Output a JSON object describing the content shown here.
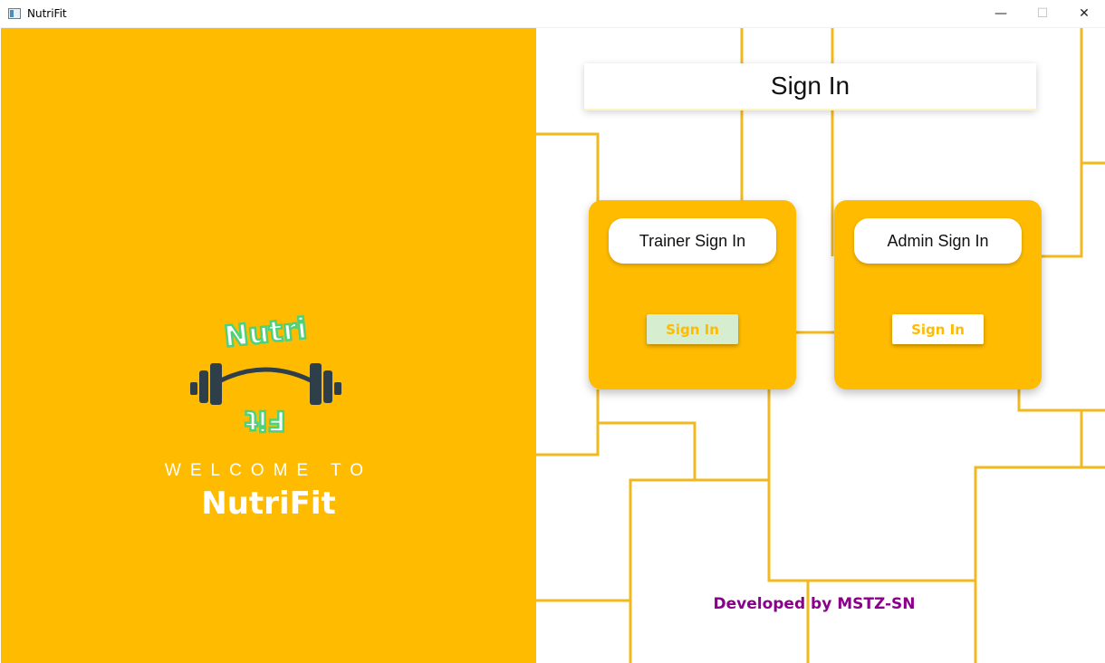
{
  "window": {
    "title": "NutriFit",
    "minimize_glyph": "—",
    "maximize_glyph": "☐",
    "close_glyph": "✕"
  },
  "left_panel": {
    "logo_top_text": "Nutri",
    "logo_bottom_text": "Fit",
    "welcome_text": "WELCOME TO",
    "brand_name": "NutriFit",
    "icons": [
      "barbell-icon"
    ]
  },
  "main": {
    "title": "Sign In",
    "trainer_card": {
      "title": "Trainer Sign In",
      "button_label": "Sign In"
    },
    "admin_card": {
      "title": "Admin Sign In",
      "button_label": "Sign In"
    },
    "footer": "Developed by MSTZ-SN"
  },
  "colors": {
    "accent": "#ffbb00",
    "footer_text": "#8b008b",
    "trainer_button_bg": "#d6edd0",
    "logo_text": "#4fd17a",
    "barbell": "#2e3f49"
  }
}
